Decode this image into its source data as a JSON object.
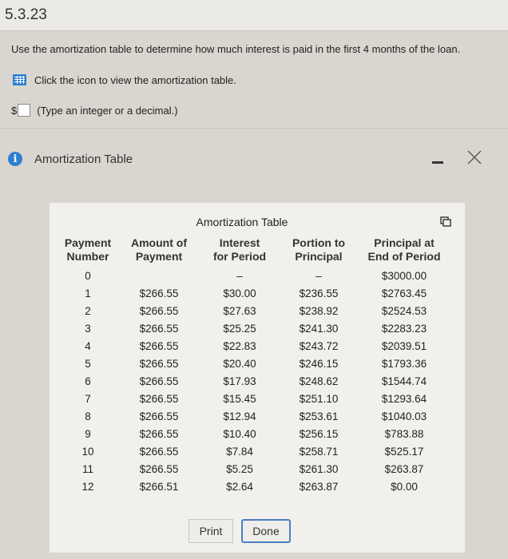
{
  "header": {
    "problem_id": "5.3.23"
  },
  "question": {
    "text": "Use the amortization table to determine how much interest is paid in the first 4 months of the loan."
  },
  "icon_link": {
    "text": "Click the icon to view the amortization table."
  },
  "answer": {
    "prefix": "$",
    "hint": "(Type an integer or a decimal.)",
    "value": ""
  },
  "popup": {
    "title": "Amortization Table",
    "table_title": "Amortization Table",
    "columns": [
      [
        "Payment",
        "Number"
      ],
      [
        "Amount of",
        "Payment"
      ],
      [
        "Interest",
        "for Period"
      ],
      [
        "Portion to",
        "Principal"
      ],
      [
        "Principal at",
        "End of Period"
      ]
    ],
    "rows": [
      [
        "0",
        "",
        "–",
        "–",
        "$3000.00"
      ],
      [
        "1",
        "$266.55",
        "$30.00",
        "$236.55",
        "$2763.45"
      ],
      [
        "2",
        "$266.55",
        "$27.63",
        "$238.92",
        "$2524.53"
      ],
      [
        "3",
        "$266.55",
        "$25.25",
        "$241.30",
        "$2283.23"
      ],
      [
        "4",
        "$266.55",
        "$22.83",
        "$243.72",
        "$2039.51"
      ],
      [
        "5",
        "$266.55",
        "$20.40",
        "$246.15",
        "$1793.36"
      ],
      [
        "6",
        "$266.55",
        "$17.93",
        "$248.62",
        "$1544.74"
      ],
      [
        "7",
        "$266.55",
        "$15.45",
        "$251.10",
        "$1293.64"
      ],
      [
        "8",
        "$266.55",
        "$12.94",
        "$253.61",
        "$1040.03"
      ],
      [
        "9",
        "$266.55",
        "$10.40",
        "$256.15",
        "$783.88"
      ],
      [
        "10",
        "$266.55",
        "$7.84",
        "$258.71",
        "$525.17"
      ],
      [
        "11",
        "$266.55",
        "$5.25",
        "$261.30",
        "$263.87"
      ],
      [
        "12",
        "$266.51",
        "$2.64",
        "$263.87",
        "$0.00"
      ]
    ],
    "buttons": {
      "print": "Print",
      "done": "Done"
    }
  },
  "colors": {
    "accent": "#2f7fd0",
    "done_border": "#4a7fc3",
    "background": "#d9d6d0",
    "panel": "#f1f0ec"
  },
  "icons": [
    "table-icon",
    "info-icon",
    "minimize-icon",
    "close-icon",
    "copy-icon"
  ]
}
